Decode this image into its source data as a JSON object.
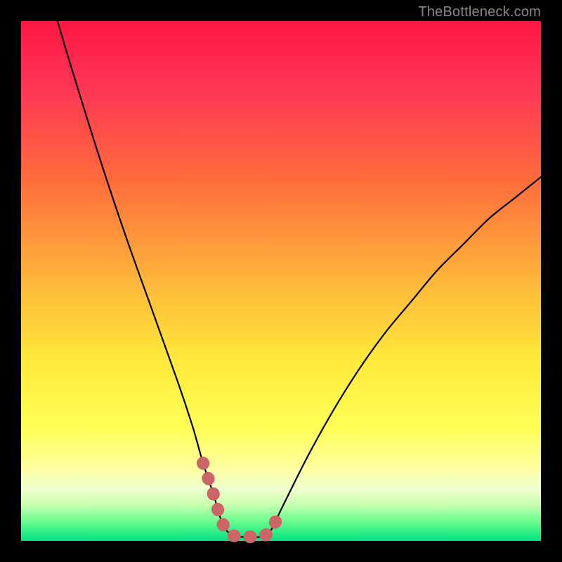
{
  "watermark": "TheBottleneck.com",
  "chart_data": {
    "type": "line",
    "title": "",
    "xlabel": "",
    "ylabel": "",
    "xlim": [
      0,
      100
    ],
    "ylim": [
      0,
      100
    ],
    "grid": false,
    "series": [
      {
        "name": "bottleneck-curve",
        "x": [
          7,
          10,
          15,
          20,
          25,
          30,
          33,
          35,
          37,
          38.5,
          40,
          42,
          44,
          46,
          48,
          50,
          55,
          60,
          65,
          70,
          75,
          80,
          85,
          90,
          95,
          100
        ],
        "y": [
          100,
          90,
          74,
          59,
          45,
          31,
          22,
          15,
          9,
          4,
          1.5,
          0.8,
          0.8,
          0.8,
          2,
          6,
          16,
          25,
          33,
          40,
          46,
          52,
          57,
          62,
          66,
          70
        ]
      }
    ],
    "highlight_segment": {
      "name": "optimal-range",
      "color": "#CC6666",
      "x": [
        35,
        37,
        38.5,
        40,
        42,
        44,
        46,
        48,
        50
      ],
      "y": [
        15,
        9,
        4,
        1.5,
        0.8,
        0.8,
        0.8,
        2,
        6
      ]
    },
    "background_gradient": {
      "stops": [
        {
          "pos": 0.0,
          "color": "#FF1744"
        },
        {
          "pos": 0.12,
          "color": "#FF3355"
        },
        {
          "pos": 0.3,
          "color": "#FF6A3C"
        },
        {
          "pos": 0.5,
          "color": "#FFB63A"
        },
        {
          "pos": 0.65,
          "color": "#FFE83A"
        },
        {
          "pos": 0.78,
          "color": "#FFFF55"
        },
        {
          "pos": 0.86,
          "color": "#FFFFA0"
        },
        {
          "pos": 0.9,
          "color": "#F0FFD0"
        },
        {
          "pos": 0.93,
          "color": "#C8FFB0"
        },
        {
          "pos": 0.96,
          "color": "#70FF90"
        },
        {
          "pos": 1.0,
          "color": "#00E080"
        }
      ]
    }
  }
}
